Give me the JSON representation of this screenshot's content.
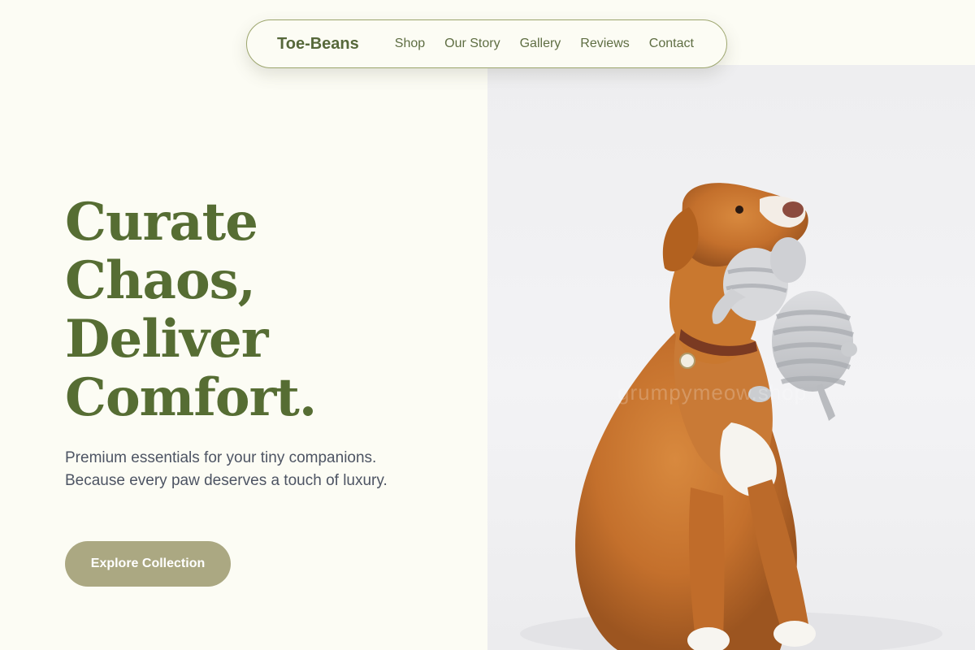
{
  "nav": {
    "brand": "Toe-Beans",
    "links": [
      "Shop",
      "Our Story",
      "Gallery",
      "Reviews",
      "Contact"
    ]
  },
  "hero": {
    "headline": [
      "Curate",
      "Chaos,",
      "Deliver",
      "Comfort."
    ],
    "subtitle": "Premium essentials for your tiny companions. Because every paw deserves a touch of luxury.",
    "cta_label": "Explore Collection",
    "image_watermark": "grumpymeow.shop"
  },
  "colors": {
    "background": "#fcfcf4",
    "brand_green": "#566d33",
    "nav_border": "#9da66e",
    "cta_background": "#aba882",
    "body_text": "#4d5463"
  },
  "icons": {
    "hero_image": "dog-with-plush-elephant-photo"
  }
}
